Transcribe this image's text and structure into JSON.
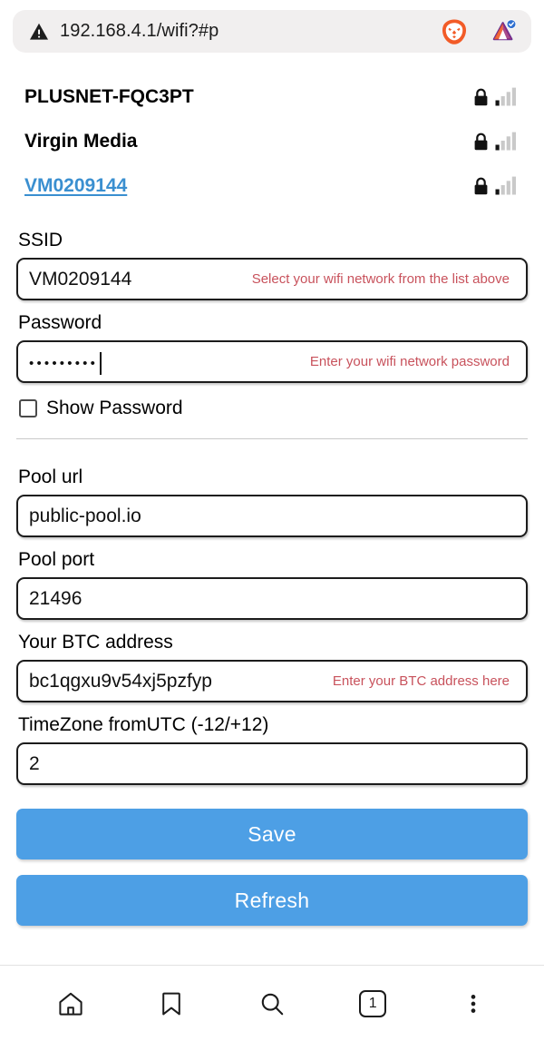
{
  "browser": {
    "url": "192.168.4.1/wifi?#p",
    "warning_icon": "warning-triangle-icon",
    "brave_icon": "brave-lion-icon",
    "bat_icon": "bat-rewards-icon",
    "bottom_nav": {
      "home_label": "home-icon",
      "bookmark_label": "bookmark-icon",
      "search_label": "search-icon",
      "tab_count": "1",
      "menu_label": "three-dot-menu-icon"
    }
  },
  "networks": [
    {
      "ssid": "PLUSNET-FQC3PT",
      "selected": false,
      "secured": true,
      "signal_bars": 1
    },
    {
      "ssid": "Virgin Media",
      "selected": false,
      "secured": true,
      "signal_bars": 1
    },
    {
      "ssid": "VM0209144",
      "selected": true,
      "secured": true,
      "signal_bars": 1
    }
  ],
  "form": {
    "ssid": {
      "label": "SSID",
      "value": "VM0209144",
      "hint": "Select your wifi network from the list above"
    },
    "password": {
      "label": "Password",
      "value": "•••••••••",
      "hint": "Enter your wifi network password"
    },
    "show_password": {
      "label": "Show Password",
      "checked": false
    },
    "pool_url": {
      "label": "Pool url",
      "value": "public-pool.io",
      "hint": ""
    },
    "pool_port": {
      "label": "Pool port",
      "value": "21496",
      "hint": ""
    },
    "btc_address": {
      "label": "Your BTC address",
      "value": "bc1qgxu9v54xj5pzfyp",
      "hint": "Enter your BTC address here"
    },
    "timezone": {
      "label": "TimeZone fromUTC (-12/+12)",
      "value": "2",
      "hint": ""
    },
    "save_label": "Save",
    "refresh_label": "Refresh"
  },
  "colors": {
    "button_blue": "#4d9fe5",
    "link_blue": "#3a8fd0",
    "hint_red": "#c8525c",
    "urlbar_bg": "#f1efef"
  }
}
